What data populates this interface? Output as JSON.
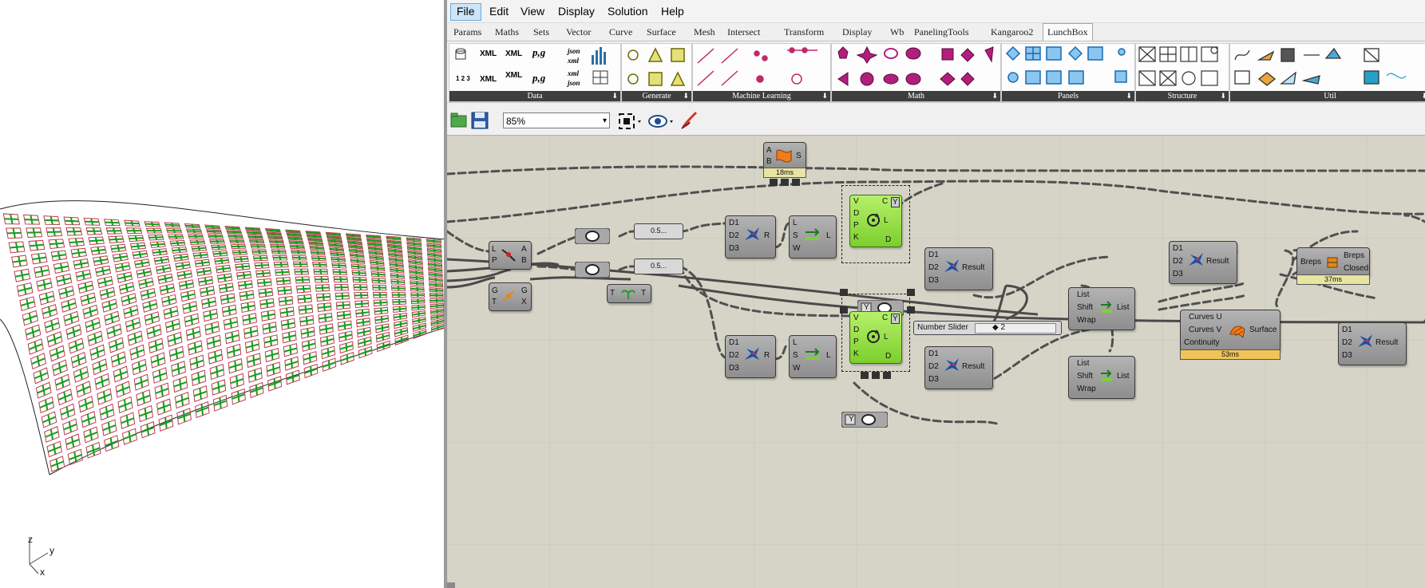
{
  "menu": [
    "File",
    "Edit",
    "View",
    "Display",
    "Solution",
    "Help"
  ],
  "tabs": [
    "Params",
    "Maths",
    "Sets",
    "Vector",
    "Curve",
    "Surface",
    "Mesh",
    "Intersect",
    "Transform",
    "Display",
    "Wb",
    "PanelingTools",
    "Kangaroo2",
    "LunchBox"
  ],
  "ribbon_groups": [
    "Data",
    "Generate",
    "Machine Learning",
    "Math",
    "Panels",
    "Structure",
    "Util"
  ],
  "ribbon_icons": {
    "data": [
      "XML",
      "XML",
      "p,g",
      "json",
      "XML",
      "XML",
      "p,g",
      "xml",
      "json",
      "XML",
      "json"
    ]
  },
  "toolbar": {
    "zoom": "85%"
  },
  "viewport_axes": {
    "z": "z",
    "y": "y",
    "x": "x"
  },
  "components": {
    "ab_surface": {
      "in": [
        "A",
        "B"
      ],
      "out": [
        "S"
      ],
      "timing": "18ms"
    },
    "lp_node": {
      "in": [
        "L",
        "P"
      ],
      "out": [
        "A",
        "B"
      ]
    },
    "gt_node": {
      "in": [
        "G",
        "T"
      ],
      "out": [
        "G",
        "X"
      ]
    },
    "tree_node": {
      "in": [
        "T"
      ],
      "out": [
        "T"
      ]
    },
    "slider_1": "0.5...",
    "slider_2": "0.5...",
    "d_node_1": {
      "in": [
        "D1",
        "D2",
        "D3"
      ],
      "out": [
        "R"
      ]
    },
    "d_node_2": {
      "in": [
        "D1",
        "D2",
        "D3"
      ],
      "out": [
        "R"
      ]
    },
    "lsw_1": {
      "in": [
        "L",
        "S",
        "W"
      ],
      "out": [
        "L"
      ]
    },
    "lsw_2": {
      "in": [
        "L",
        "S",
        "W"
      ],
      "out": [
        "L"
      ]
    },
    "loop_1": {
      "in": [
        "V",
        "D",
        "P",
        "K"
      ],
      "out": [
        "C",
        "L",
        "D"
      ],
      "badge": "Y"
    },
    "loop_2": {
      "in": [
        "V",
        "D",
        "P",
        "K"
      ],
      "out": [
        "C",
        "L",
        "D"
      ],
      "badge": "Y"
    },
    "result_1": {
      "in": [
        "D1",
        "D2",
        "D3"
      ],
      "out": "Result"
    },
    "result_2": {
      "in": [
        "D1",
        "D2",
        "D3"
      ],
      "out": "Result"
    },
    "result_3": {
      "in": [
        "D1",
        "D2",
        "D3"
      ],
      "out": "Result"
    },
    "result_4": {
      "in": [
        "D1",
        "D2",
        "D3"
      ],
      "out": "Result"
    },
    "shift_1": {
      "in": [
        "List",
        "Shift",
        "Wrap"
      ],
      "out": "List"
    },
    "shift_2": {
      "in": [
        "List",
        "Shift",
        "Wrap"
      ],
      "out": "List"
    },
    "number_slider": {
      "label": "Number Slider",
      "value": "◆ 2"
    },
    "loft": {
      "in": [
        "Curves U",
        "Curves V",
        "Continuity"
      ],
      "out": "Surface",
      "timing": "53ms"
    },
    "breps": {
      "in": "Breps",
      "out": [
        "Breps",
        "Closed"
      ],
      "timing": "37ms"
    },
    "y_toggle_1": "Y",
    "y_toggle_2": "Y"
  },
  "colors": {
    "canvas": "#d6d4c7",
    "green_component": "#8fdc3c",
    "grid_green": "#1a9a1a",
    "grid_red": "#c0394f"
  }
}
